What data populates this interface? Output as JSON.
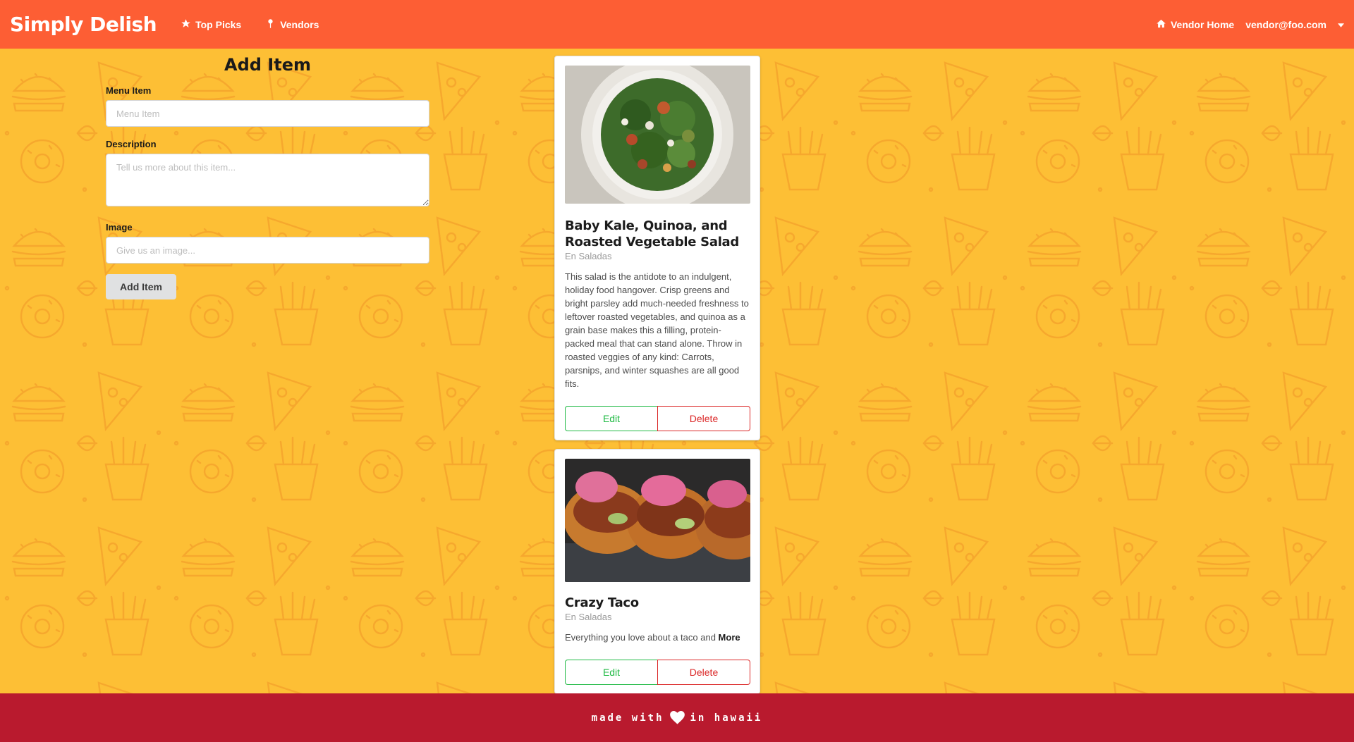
{
  "navbar": {
    "brand": "Simply Delish",
    "top_picks": "Top Picks",
    "vendors": "Vendors",
    "vendor_home": "Vendor Home",
    "user_email": "vendor@foo.com"
  },
  "form": {
    "title": "Add Item",
    "menu_item_label": "Menu Item",
    "menu_item_placeholder": "Menu Item",
    "description_label": "Description",
    "description_placeholder": "Tell us more about this item...",
    "image_label": "Image",
    "image_placeholder": "Give us an image...",
    "submit_label": "Add Item"
  },
  "items": [
    {
      "title": "Baby Kale, Quinoa, and Roasted Vegetable Salad",
      "vendor": "En Saladas",
      "description": "This salad is the antidote to an indulgent, holiday food hangover. Crisp greens and bright parsley add much-needed freshness to leftover roasted vegetables, and quinoa as a grain base makes this a filling, protein-packed meal that can stand alone. Throw in roasted veggies of any kind: Carrots, parsnips, and winter squashes are all good fits.",
      "edit_label": "Edit",
      "delete_label": "Delete"
    },
    {
      "title": "Crazy Taco",
      "vendor": "En Saladas",
      "description": "Everything you love about a taco and ",
      "more_label": "More",
      "edit_label": "Edit",
      "delete_label": "Delete"
    }
  ],
  "footer": {
    "before_heart": "made with",
    "after_heart": "in hawaii"
  },
  "colors": {
    "navbar": "#fd5e34",
    "background": "#fdbf35",
    "footer": "#b91a2e",
    "edit": "#21ba45",
    "delete": "#db2828"
  },
  "icons": {
    "top_picks": "star-icon",
    "vendors": "map-pin-icon",
    "vendor_home": "home-icon",
    "user_menu": "caret-down-icon",
    "footer": "heart-icon"
  }
}
